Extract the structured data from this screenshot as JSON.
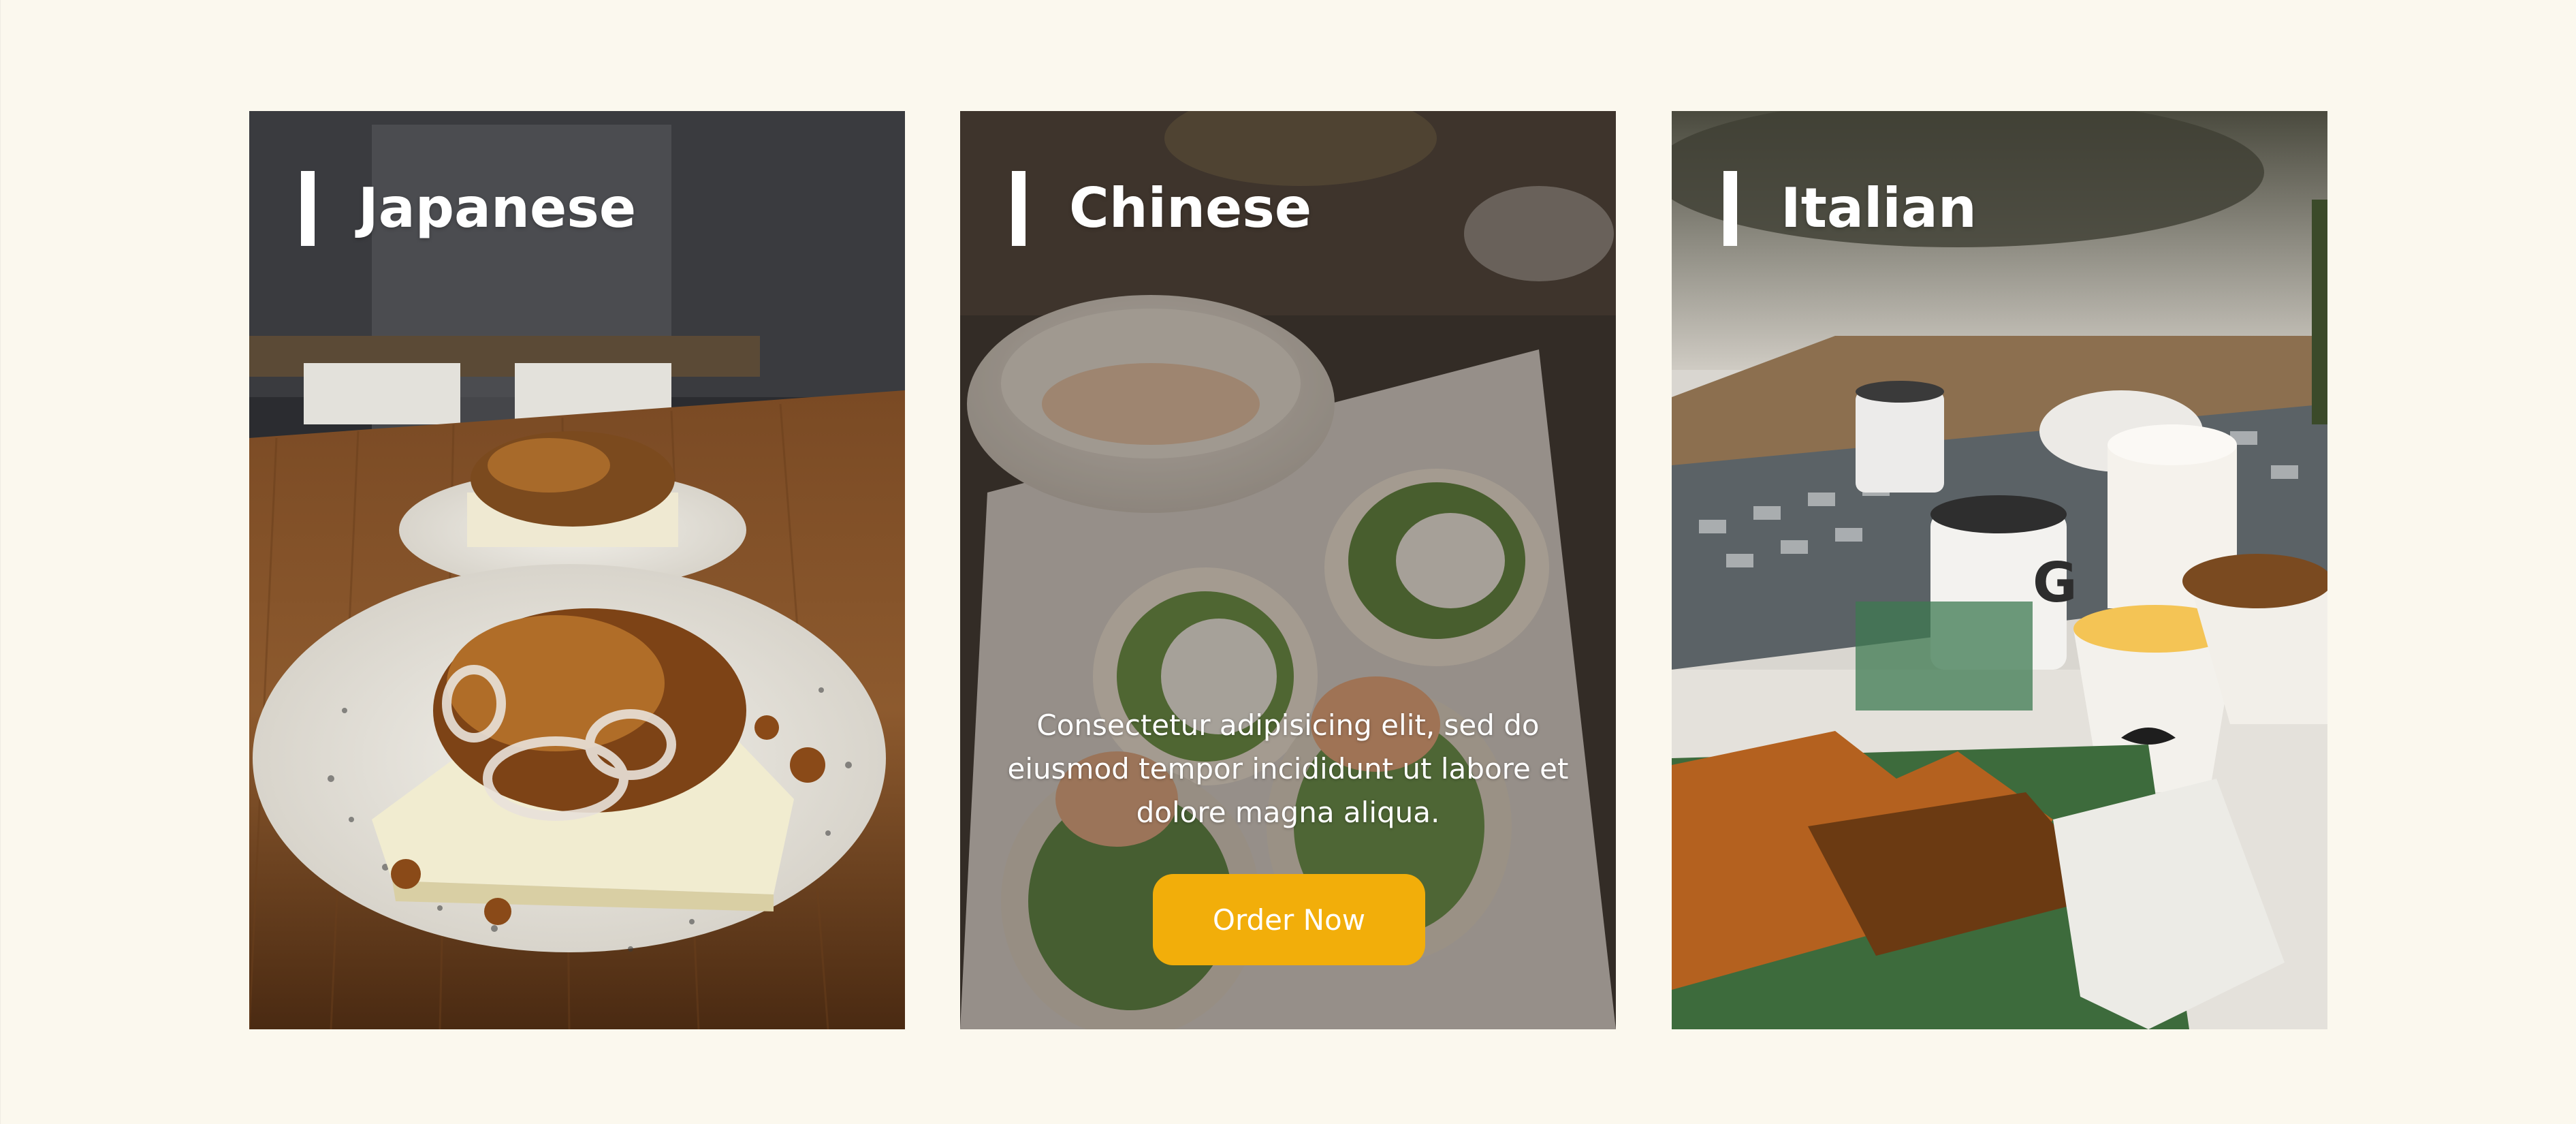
{
  "cards": [
    {
      "title": "Japanese"
    },
    {
      "title": "Chinese",
      "description": "Consectetur adipisicing elit, sed do eiusmod tempor incididunt ut labore et dolore magna aliqua.",
      "button_label": "Order Now"
    },
    {
      "title": "Italian"
    }
  ],
  "colors": {
    "page_background": "#fbf8ee",
    "accent": "#f2ae0a",
    "text_on_image": "#ffffff"
  }
}
